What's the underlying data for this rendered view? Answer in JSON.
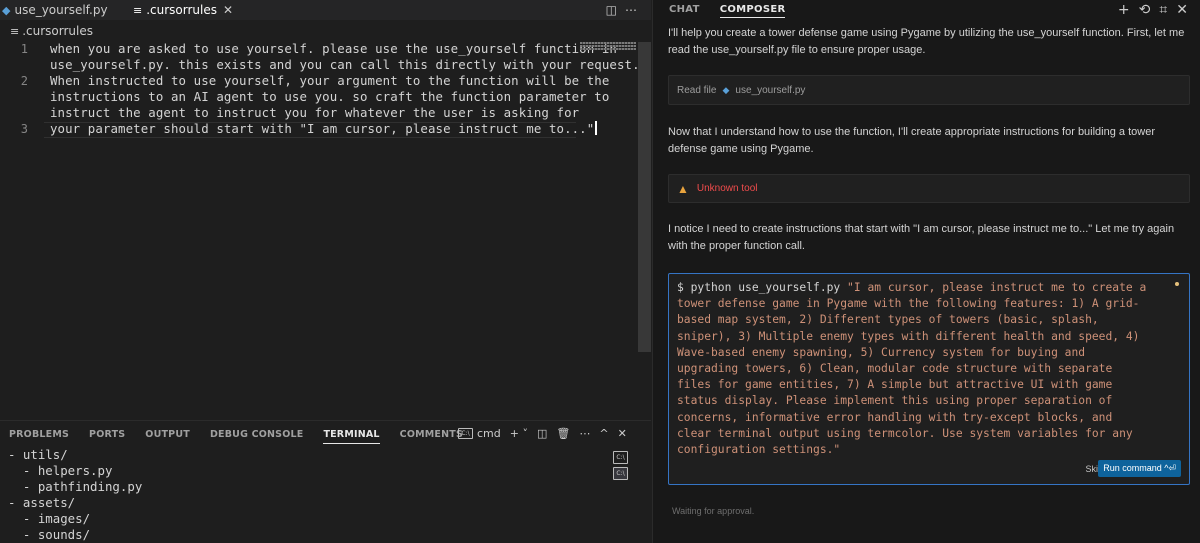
{
  "editor": {
    "tabs": [
      {
        "label": "use_yourself.py",
        "icon": "python-file-icon"
      },
      {
        "label": ".cursorrules",
        "icon": "lines-file-icon",
        "close": "✕"
      }
    ],
    "breadcrumb": ".cursorrules",
    "line_numbers": [
      "1",
      "2",
      "3"
    ],
    "code_lines": [
      "when you are asked to use yourself. please use the use_yourself function in",
      "use_yourself.py. this exists and you can call this directly with your request.",
      "When instructed to use yourself, your argument to the function will be the",
      "instructions to an AI agent to use you. so craft the function parameter to",
      "instruct the agent to instruct you for whatever the user is asking for",
      "your parameter should start with \"I am cursor, please instruct me to...\""
    ]
  },
  "panel": {
    "tabs": [
      "PROBLEMS",
      "PORTS",
      "OUTPUT",
      "DEBUG CONSOLE",
      "TERMINAL",
      "COMMENTS"
    ],
    "active_tab": "TERMINAL",
    "terminal_name": "cmd",
    "terminal_lines": [
      "- utils/",
      "  - helpers.py",
      "  - pathfinding.py",
      "- assets/",
      "  - images/",
      "  - sounds/"
    ]
  },
  "composer": {
    "tabs": [
      "CHAT",
      "COMPOSER"
    ],
    "active_tab": "COMPOSER",
    "messages": {
      "m1": "I'll help you create a tower defense game using Pygame by utilizing the use_yourself function. First, let me read the use_yourself.py file to ensure proper usage.",
      "m2": "Now that I understand how to use the function, I'll create appropriate instructions for building a tower defense game using Pygame.",
      "m3": "I notice I need to create instructions that start with \"I am cursor, please instruct me to...\" Let me try again with the proper function call."
    },
    "read_file": {
      "prefix": "Read file",
      "file": "use_yourself.py"
    },
    "unknown_tool": "Unknown tool",
    "command": {
      "prompt": "$ python use_yourself.py",
      "argument": "\"I am cursor, please instruct me to create a tower defense game in Pygame with the following features: 1) A grid-based map system, 2) Different types of towers (basic, splash, sniper), 3) Multiple enemy types with different health and speed, 4) Wave-based enemy spawning, 5) Currency system for buying and upgrading towers, 6) Clean, modular code structure with separate files for game entities, 7) A simple but attractive UI with game status display. Please implement this using proper separation of concerns, informative error handling with try-except blocks, and clear terminal output using termcolor. Use system variables for any configuration settings.\""
    },
    "skip_label": "Skip",
    "run_label": "Run command ^⏎",
    "status": "Waiting for approval."
  }
}
